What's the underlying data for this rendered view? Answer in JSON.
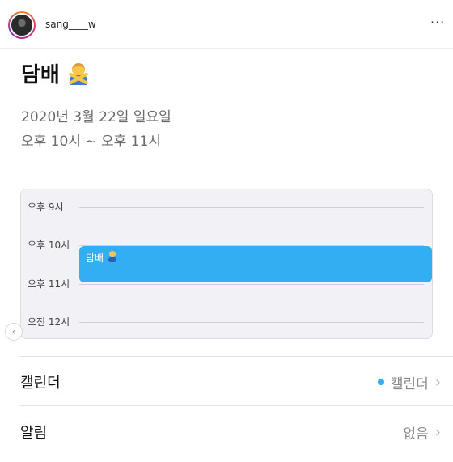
{
  "post": {
    "username": "sang____w",
    "more": "···"
  },
  "event": {
    "title": "담배",
    "date": "2020년 3월 22일 일요일",
    "time": "오후 10시 ~ 오후 11시",
    "block_label": "담배"
  },
  "timeline": {
    "hours": [
      "오후 9시",
      "오후 10시",
      "오후 11시",
      "오전 12시"
    ]
  },
  "details": {
    "calendar_label": "캘린더",
    "calendar_value": "캘린더",
    "calendar_color": "#32aef2",
    "alert_label": "알림",
    "alert_value": "없음"
  }
}
